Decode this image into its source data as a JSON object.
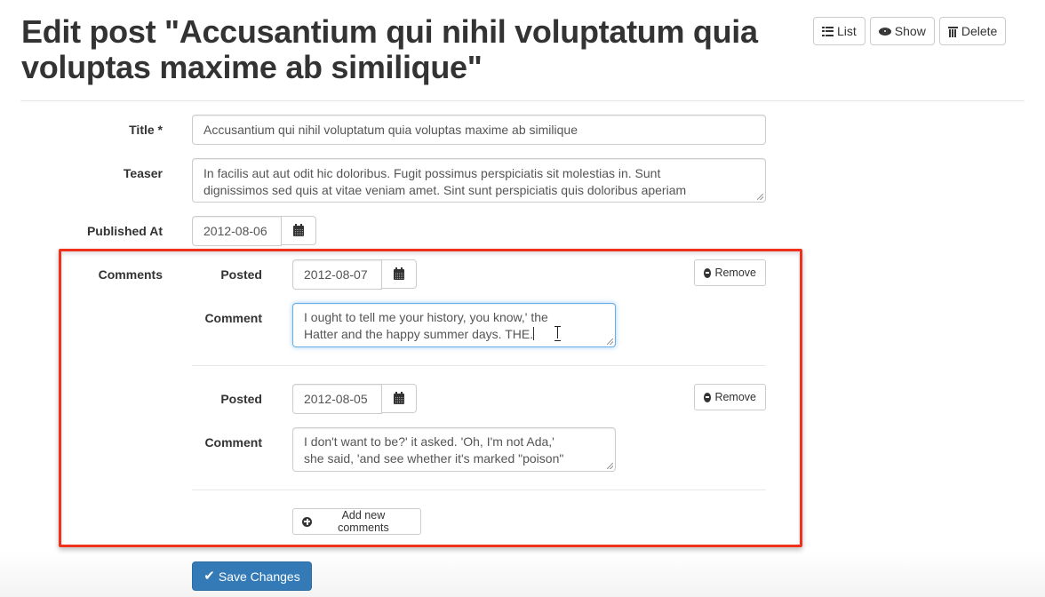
{
  "header": {
    "title": "Edit post \"Accusantium qui nihil voluptatum quia voluptas maxime ab similique\"",
    "actions": {
      "list_label": "List",
      "show_label": "Show",
      "delete_label": "Delete"
    }
  },
  "form": {
    "title": {
      "label": "Title *",
      "value": "Accusantium qui nihil voluptatum quia voluptas maxime ab similique"
    },
    "teaser": {
      "label": "Teaser",
      "line1": "In facilis aut aut odit hic doloribus. Fugit possimus perspiciatis sit molestias in. Sunt",
      "line2": "dignissimos sed quis at vitae veniam amet. Sint sunt perspiciatis quis doloribus aperiam"
    },
    "published_at": {
      "label": "Published At",
      "value": "2012-08-06"
    },
    "comments": {
      "label": "Comments",
      "items": [
        {
          "posted_label": "Posted",
          "posted_value": "2012-08-07",
          "comment_label": "Comment",
          "comment_line1": "I ought to tell me your history, you know,' the",
          "comment_line2": "Hatter and the happy summer days. THE.",
          "remove_label": "Remove"
        },
        {
          "posted_label": "Posted",
          "posted_value": "2012-08-05",
          "comment_label": "Comment",
          "comment_line1": "I don't want to be?' it asked. 'Oh, I'm not Ada,'",
          "comment_line2": "she said, 'and see whether it's marked \"poison\"",
          "remove_label": "Remove"
        }
      ],
      "add_label": "Add new comments"
    },
    "save_label": "Save Changes"
  },
  "colors": {
    "highlight": "#f0321c",
    "primary": "#337ab7",
    "focus": "#66afe9"
  }
}
